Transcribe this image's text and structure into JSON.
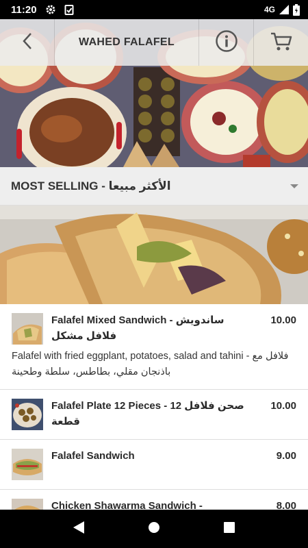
{
  "status_bar": {
    "time": "11:20",
    "network": "4G",
    "icons": [
      "settings-icon",
      "clipboard-check-icon",
      "signal-icon",
      "battery-icon"
    ]
  },
  "header": {
    "title": "WAHED FALAFEL",
    "icons": [
      "back-arrow-icon",
      "info-icon",
      "cart-icon"
    ]
  },
  "category": {
    "label": "MOST SELLING - الأكثر مبيعا",
    "icon": "dropdown-arrow-icon"
  },
  "menu": {
    "items": [
      {
        "name": "Falafel Mixed Sandwich - ساندويش فلافل مشكل",
        "price": "10.00",
        "description": "Falafel with fried eggplant, potatoes, salad and tahini - فلافل مع باذنجان مقلي، بطاطس، سلطة وطحينة"
      },
      {
        "name": "Falafel Plate 12 Pieces - صحن فلافل 12 قطعة",
        "price": "10.00",
        "description": ""
      },
      {
        "name": "Falafel Sandwich",
        "price": "9.00",
        "description": ""
      },
      {
        "name": "Chicken Shawarma Sandwich - ساندويتش",
        "price": "8.00",
        "description": ""
      }
    ]
  },
  "nav_bar": {
    "icons": [
      "back-triangle-icon",
      "home-circle-icon",
      "recents-square-icon"
    ]
  },
  "colors": {
    "status_bar": "#000000",
    "header_overlay": "#ebebeb",
    "category_bar": "#eeeeee",
    "divider": "#dddddd",
    "text": "#2a2a2a"
  }
}
